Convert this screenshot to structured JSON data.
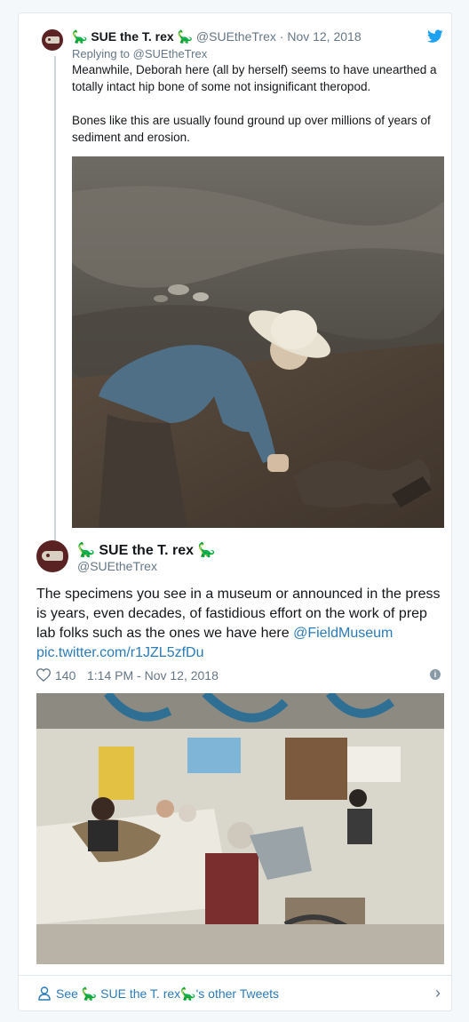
{
  "reply_tweet": {
    "name_prefix_emoji": "🦕",
    "name": "SUE the T. rex",
    "name_suffix_emoji": "🦕",
    "handle": "@SUEtheTrex",
    "separator": "·",
    "date": "Nov 12, 2018",
    "replying_to_label": "Replying to",
    "replying_to_handle": "@SUEtheTrex",
    "paragraph_1": "Meanwhile, Deborah here (all by herself) seems to have unearthed a totally intact hip bone of some not insignificant theropod.",
    "paragraph_2": "Bones like this are usually found ground up over millions of years of sediment and erosion."
  },
  "main_tweet": {
    "name_prefix_emoji": "🦕",
    "name": "SUE the T. rex",
    "name_suffix_emoji": "🦕",
    "handle": "@SUEtheTrex",
    "text": "The specimens you see in a museum or announced in the press is years, even decades, of fastidious effort on the work of prep lab folks such as the ones we have here",
    "mention": "@FieldMuseum",
    "pic_link": "pic.twitter.com/r1JZL5zfDu",
    "likes": "140",
    "timestamp": "1:14 PM - Nov 12, 2018"
  },
  "see_more": {
    "prefix": "See",
    "name_prefix_emoji": "🦕",
    "name": "SUE the T. rex",
    "name_suffix_emoji": "🦕",
    "suffix": "'s other Tweets"
  },
  "icons": {
    "twitter": "twitter-bird-icon",
    "heart": "heart-icon",
    "info": "info-icon",
    "person": "person-icon",
    "chevron": "chevron-right-icon"
  },
  "colors": {
    "link": "#2b7bb9",
    "muted": "#657786",
    "border": "#e1e8ed",
    "twitter_blue": "#1da1f2"
  }
}
